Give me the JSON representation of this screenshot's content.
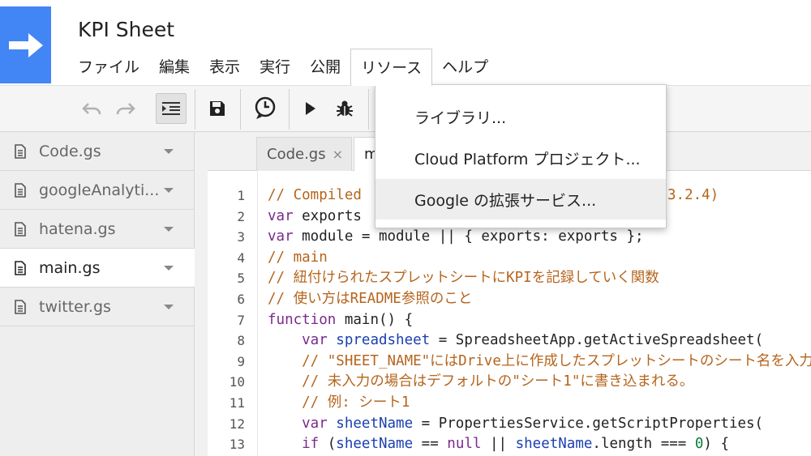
{
  "app": {
    "title": "KPI Sheet"
  },
  "menu": {
    "items": [
      {
        "label": "ファイル"
      },
      {
        "label": "編集"
      },
      {
        "label": "表示"
      },
      {
        "label": "実行"
      },
      {
        "label": "公開"
      },
      {
        "label": "リソース",
        "open": true
      },
      {
        "label": "ヘルプ"
      }
    ]
  },
  "resources_menu": {
    "items": [
      {
        "label": "ライブラリ..."
      },
      {
        "label": "Cloud Platform プロジェクト..."
      },
      {
        "label": "Google の拡張サービス...",
        "hovered": true
      }
    ]
  },
  "toolbar": {
    "icons": [
      "undo-icon",
      "redo-icon",
      "indent-icon",
      "save-icon",
      "triggers-clock-icon",
      "run-icon",
      "debug-bug-icon"
    ]
  },
  "files": [
    {
      "name": "Code.gs"
    },
    {
      "name": "googleAnalyti..."
    },
    {
      "name": "hatena.gs"
    },
    {
      "name": "main.gs",
      "active": true
    },
    {
      "name": "twitter.gs"
    }
  ],
  "tabs": [
    {
      "label": "Code.gs",
      "close": "×"
    },
    {
      "label": "m"
    }
  ],
  "code": {
    "line_numbers": [
      "1",
      "2",
      "3",
      "4",
      "5",
      "6",
      "7",
      "8",
      "9",
      "10",
      "11",
      "12",
      "13"
    ],
    "lines": {
      "l1a": "// Compiled ",
      "l1b": "3.2.4)",
      "l2a": "var",
      "l2b": " exports",
      "l3a": "var",
      "l3b": " module = module || { exports: exports };",
      "l4": "// main",
      "l5": "// 紐付けられたスプレットシートにKPIを記録していく関数",
      "l6": "// 使い方はREADME参照のこと",
      "l7a": "function",
      "l7b": " main() {",
      "l8a": "    var ",
      "l8b": "spreadsheet",
      "l8c": " = SpreadsheetApp.getActiveSpreadsheet(",
      "l9": "    // \"SHEET_NAME\"にはDrive上に作成したスプレットシートのシート名を入力",
      "l10": "    // 未入力の場合はデフォルトの\"シート1\"に書き込まれる。",
      "l11": "    // 例: シート1",
      "l12a": "    var ",
      "l12b": "sheetName",
      "l12c": " = PropertiesService.getScriptProperties(",
      "l13a": "    if",
      "l13b": " (",
      "l13c": "sheetName",
      "l13d": " == ",
      "l13e": "null",
      "l13f": " || ",
      "l13g": "sheetName",
      "l13h": ".length === ",
      "l13i": "0",
      "l13j": ") {"
    }
  },
  "colors": {
    "brand": "#4285f4",
    "comment": "#b5651d",
    "keyword": "#7a2a8c",
    "variable": "#1a3fb0"
  }
}
